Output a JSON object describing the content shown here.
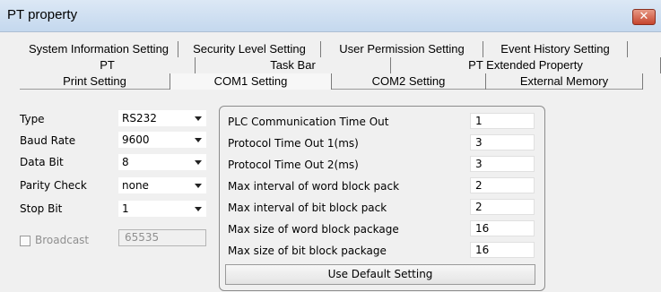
{
  "window": {
    "title": "PT property",
    "close_glyph": "✕"
  },
  "tabs": {
    "row1": [
      "System Information Setting",
      "Security Level Setting",
      "User Permission Setting",
      "Event History Setting"
    ],
    "row2": [
      "PT",
      "Task Bar",
      "PT Extended Property"
    ],
    "row3": [
      "Print Setting",
      "COM1 Setting",
      "COM2 Setting",
      "External Memory"
    ],
    "selected": "COM1 Setting"
  },
  "com": {
    "fields": [
      {
        "label": "Type",
        "value": "RS232"
      },
      {
        "label": "Baud Rate",
        "value": "9600"
      },
      {
        "label": "Data Bit",
        "value": "8"
      },
      {
        "label": "Parity Check",
        "value": "none"
      },
      {
        "label": "Stop Bit",
        "value": "1"
      }
    ],
    "broadcast": {
      "label": "Broadcast",
      "value": "65535",
      "checked": false
    }
  },
  "protocol": {
    "params": [
      {
        "label": "PLC Communication Time Out",
        "value": "1"
      },
      {
        "label": "Protocol Time Out 1(ms)",
        "value": "3"
      },
      {
        "label": "Protocol Time Out 2(ms)",
        "value": "3"
      },
      {
        "label": "Max interval of word block pack",
        "value": "2"
      },
      {
        "label": "Max interval of bit block pack",
        "value": "2"
      },
      {
        "label": "Max size of word block package",
        "value": "16"
      },
      {
        "label": "Max size of bit block package",
        "value": "16"
      }
    ],
    "default_button": "Use Default Setting"
  }
}
